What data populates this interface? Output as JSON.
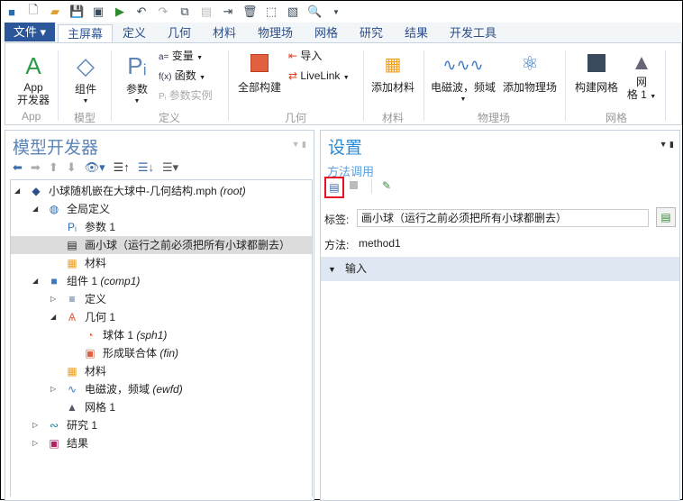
{
  "quick_access": {
    "icons": [
      "app-icon",
      "new-icon",
      "open-icon",
      "save-icon",
      "save-as-icon",
      "run-icon",
      "undo-icon",
      "redo-icon",
      "copy-icon",
      "paste-icon",
      "duplicate-icon",
      "delete-icon",
      "select-icon",
      "clear-icon",
      "find-icon"
    ]
  },
  "tabs": {
    "file": "文件 ▾",
    "items": [
      "主屏幕",
      "定义",
      "几何",
      "材料",
      "物理场",
      "网格",
      "研究",
      "结果",
      "开发工具"
    ],
    "active": 0
  },
  "ribbon": {
    "app_builder": "App\n开发器",
    "app_group": "App",
    "component": "组件",
    "model_group": "模型",
    "parameters": "参数",
    "variables": "变量",
    "functions": "函数",
    "param_case": "参数实例",
    "definitions_group": "定义",
    "build_all": "全部构建",
    "import": "导入",
    "livelink": "LiveLink",
    "geometry_group": "几何",
    "add_material": "添加材料",
    "materials_group": "材料",
    "emw": "电磁波，频域",
    "add_physics": "添加物理场",
    "physics_group": "物理场",
    "build_mesh": "构建网格",
    "mesh1_a": "网",
    "mesh1_b": "格 1",
    "mesh_group": "网格"
  },
  "model_builder": {
    "title": "模型开发器",
    "tree": [
      {
        "label": "小球随机嵌在大球中-几何结构.mph",
        "tag": "(root)"
      },
      {
        "label": "全局定义",
        "tag": ""
      },
      {
        "label": "参数 1",
        "tag": ""
      },
      {
        "label": "画小球（运行之前必须把所有小球都删去）",
        "tag": ""
      },
      {
        "label": "材料",
        "tag": ""
      },
      {
        "label": "组件 1",
        "tag": "(comp1)"
      },
      {
        "label": "定义",
        "tag": ""
      },
      {
        "label": "几何 1",
        "tag": ""
      },
      {
        "label": "球体 1",
        "tag": "(sph1)"
      },
      {
        "label": "形成联合体",
        "tag": "(fin)"
      },
      {
        "label": "材料",
        "tag": ""
      },
      {
        "label": "电磁波，频域",
        "tag": "(ewfd)"
      },
      {
        "label": "网格 1",
        "tag": ""
      },
      {
        "label": "研究 1",
        "tag": ""
      },
      {
        "label": "结果",
        "tag": ""
      }
    ]
  },
  "settings": {
    "title": "设置",
    "subtitle": "方法调用",
    "label_caption": "标签:",
    "label_value": "画小球（运行之前必须把所有小球都删去）",
    "method_caption": "方法:",
    "method_value": "method1",
    "section_input": "输入"
  },
  "colors": {
    "accent": "#2b579a",
    "highlight": "#e81123",
    "section_bg": "#dfe8f2"
  }
}
